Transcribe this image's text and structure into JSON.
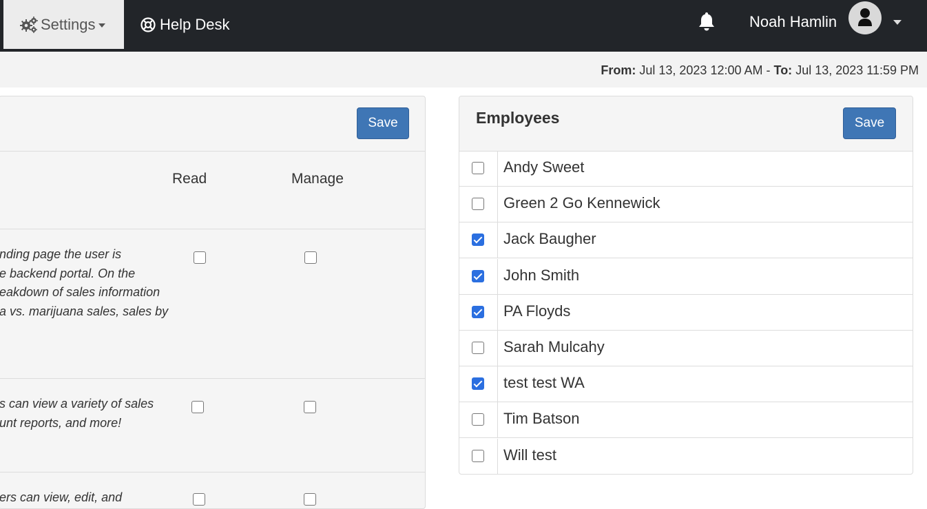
{
  "nav": {
    "settings_label": "Settings",
    "help_label": "Help Desk",
    "user_name": "Noah Hamlin"
  },
  "date_range": {
    "from_label": "From:",
    "from_value": "Jul 13, 2023 12:00 AM",
    "separator": "-",
    "to_label": "To:",
    "to_value": "Jul 13, 2023 11:59 PM"
  },
  "permissions": {
    "save_label": "Save",
    "columns": [
      "Read",
      "Manage"
    ],
    "rows": [
      {
        "description": "nding page the user is\ne backend portal. On the\neakdown of sales information\na vs. marijuana sales, sales by",
        "read": false,
        "manage": false
      },
      {
        "description": "s can view a variety of sales\nunt reports, and more!",
        "read": false,
        "manage": false
      },
      {
        "description": "ers can view, edit, and",
        "read": false,
        "manage": false
      }
    ]
  },
  "employees": {
    "title": "Employees",
    "save_label": "Save",
    "list": [
      {
        "name": "Andy Sweet",
        "checked": false
      },
      {
        "name": "Green 2 Go Kennewick",
        "checked": false
      },
      {
        "name": "Jack Baugher",
        "checked": true
      },
      {
        "name": "John Smith",
        "checked": true
      },
      {
        "name": "PA Floyds",
        "checked": true
      },
      {
        "name": "Sarah Mulcahy",
        "checked": false
      },
      {
        "name": "test test WA",
        "checked": true
      },
      {
        "name": "Tim Batson",
        "checked": false
      },
      {
        "name": "Will test",
        "checked": false
      }
    ]
  },
  "colors": {
    "navbar": "#222529",
    "primary_button": "#3f76b5",
    "checkbox_checked": "#2b6fe0"
  }
}
